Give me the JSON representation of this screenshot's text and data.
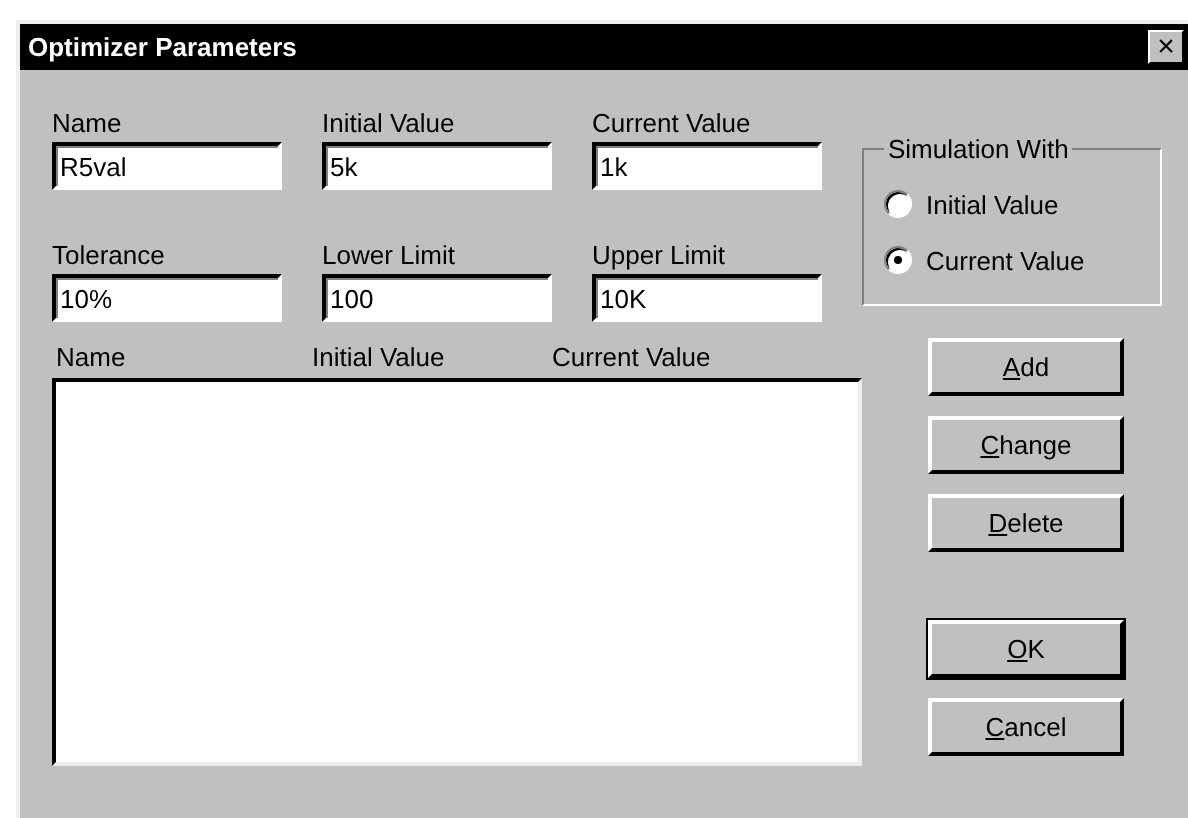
{
  "window": {
    "title": "Optimizer Parameters",
    "close": "×"
  },
  "fields": [
    {
      "label": "Name",
      "value": "R5val"
    },
    {
      "label": "Initial Value",
      "value": "5k"
    },
    {
      "label": "Current Value",
      "value": "1k"
    },
    {
      "label": "Tolerance",
      "value": "10%"
    },
    {
      "label": "Lower Limit",
      "value": "100"
    },
    {
      "label": "Upper Limit",
      "value": "10K"
    }
  ],
  "simulation_with": {
    "title": "Simulation With",
    "options": [
      {
        "label": "Initial Value",
        "selected": false
      },
      {
        "label": "Current Value",
        "selected": true
      }
    ]
  },
  "list": {
    "columns": [
      "Name",
      "Initial Value",
      "Current Value"
    ]
  },
  "buttons": [
    {
      "label": "Add",
      "mnemonic": true,
      "default": false
    },
    {
      "label": "Change",
      "mnemonic": true,
      "default": false
    },
    {
      "label": "Delete",
      "mnemonic": true,
      "default": false
    },
    {
      "label": "OK",
      "mnemonic": true,
      "default": true
    },
    {
      "label": "Cancel",
      "mnemonic": true,
      "default": false
    }
  ]
}
